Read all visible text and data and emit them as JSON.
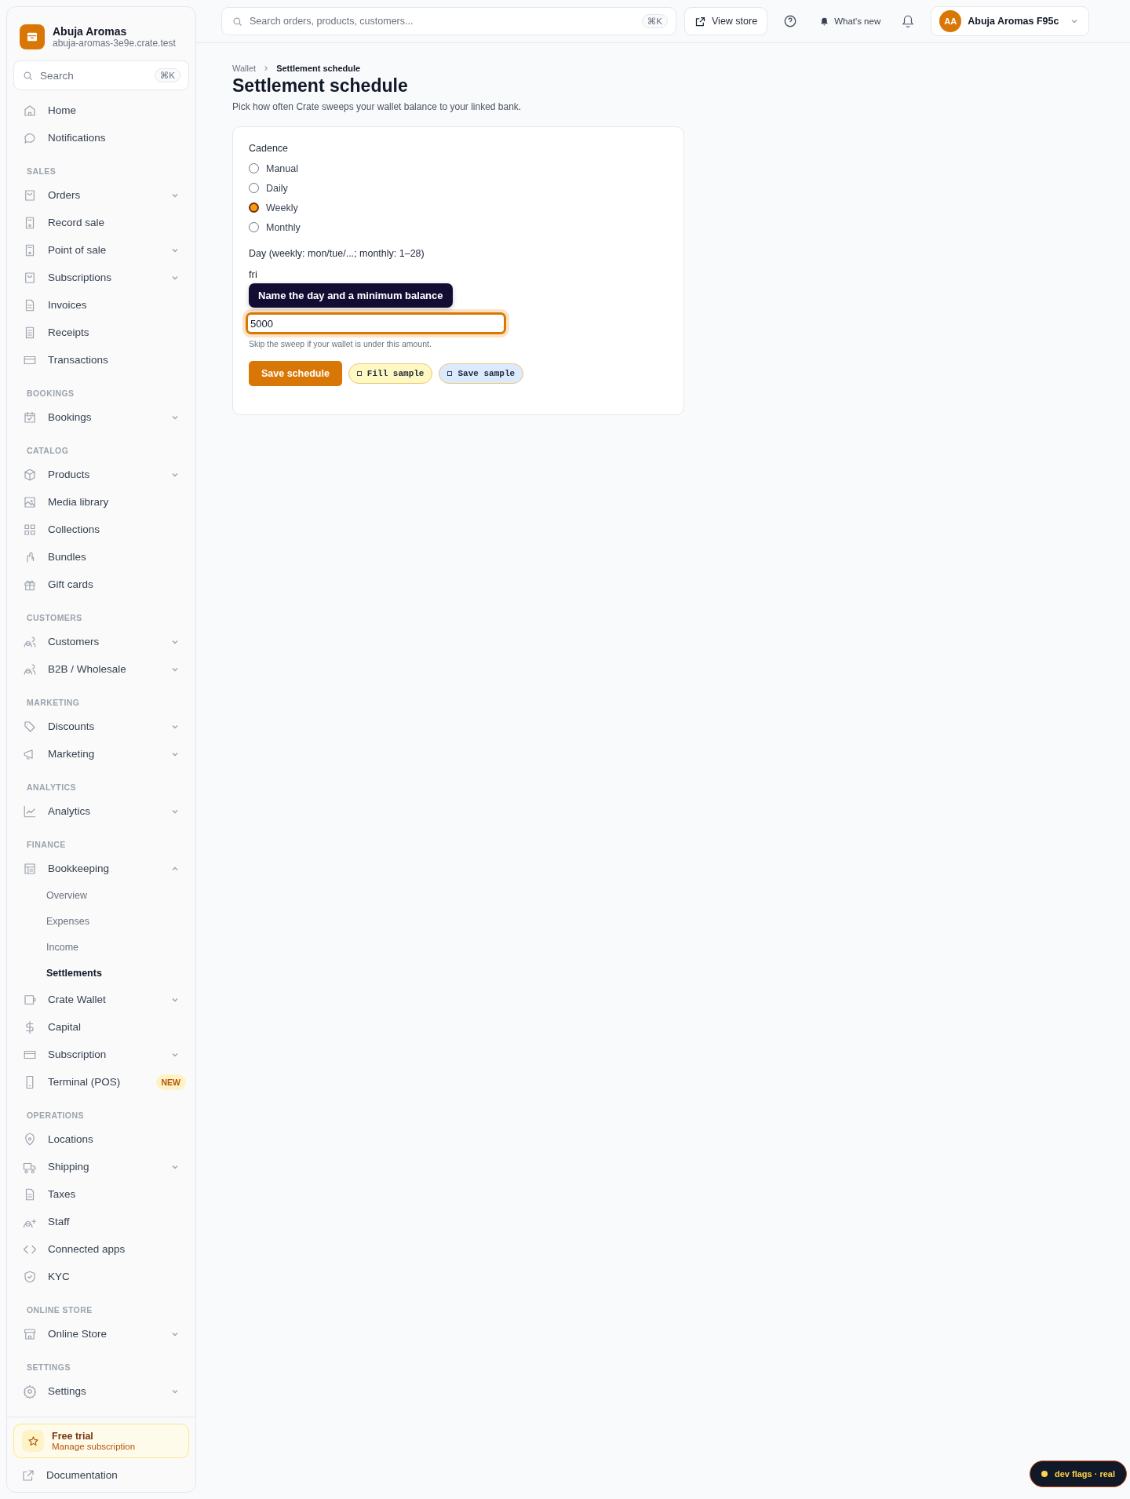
{
  "store": {
    "name": "Abuja Aromas",
    "domain": "abuja-aromas-3e9e.crate.test"
  },
  "sidebar_search": {
    "placeholder": "Search",
    "shortcut": "⌘K"
  },
  "sidebar": {
    "top_items": [
      {
        "label": "Home"
      },
      {
        "label": "Notifications"
      }
    ],
    "sections": [
      {
        "title": "SALES",
        "items": [
          {
            "label": "Orders",
            "expanded": false
          },
          {
            "label": "Record sale"
          },
          {
            "label": "Point of sale",
            "expanded": false
          },
          {
            "label": "Subscriptions",
            "expanded": false
          },
          {
            "label": "Invoices"
          },
          {
            "label": "Receipts"
          },
          {
            "label": "Transactions"
          }
        ]
      },
      {
        "title": "BOOKINGS",
        "items": [
          {
            "label": "Bookings",
            "expanded": false
          }
        ]
      },
      {
        "title": "CATALOG",
        "items": [
          {
            "label": "Products",
            "expanded": false
          },
          {
            "label": "Media library"
          },
          {
            "label": "Collections"
          },
          {
            "label": "Bundles"
          },
          {
            "label": "Gift cards"
          }
        ]
      },
      {
        "title": "CUSTOMERS",
        "items": [
          {
            "label": "Customers",
            "expanded": false
          },
          {
            "label": "B2B / Wholesale",
            "expanded": false
          }
        ]
      },
      {
        "title": "MARKETING",
        "items": [
          {
            "label": "Discounts",
            "expanded": false
          },
          {
            "label": "Marketing",
            "expanded": false
          }
        ]
      },
      {
        "title": "ANALYTICS",
        "items": [
          {
            "label": "Analytics",
            "expanded": false
          }
        ]
      },
      {
        "title": "FINANCE",
        "items": [
          {
            "label": "Bookkeeping",
            "expanded": true,
            "children": [
              {
                "label": "Overview",
                "selected": false
              },
              {
                "label": "Expenses",
                "selected": false
              },
              {
                "label": "Income",
                "selected": false
              },
              {
                "label": "Settlements",
                "selected": true
              }
            ]
          },
          {
            "label": "Crate Wallet",
            "expanded": false
          },
          {
            "label": "Capital"
          },
          {
            "label": "Subscription",
            "expanded": false
          },
          {
            "label": "Terminal (POS)",
            "badge": "NEW"
          }
        ]
      },
      {
        "title": "OPERATIONS",
        "items": [
          {
            "label": "Locations"
          },
          {
            "label": "Shipping",
            "expanded": false
          },
          {
            "label": "Taxes"
          },
          {
            "label": "Staff"
          },
          {
            "label": "Connected apps"
          },
          {
            "label": "KYC"
          }
        ]
      },
      {
        "title": "ONLINE STORE",
        "items": [
          {
            "label": "Online Store",
            "expanded": false
          }
        ]
      },
      {
        "title": "SETTINGS",
        "items": [
          {
            "label": "Settings",
            "expanded": false
          }
        ]
      }
    ],
    "trial": {
      "title": "Free trial",
      "link": "Manage subscription"
    },
    "footer_link": "Documentation"
  },
  "topbar": {
    "search": {
      "placeholder": "Search orders, products, customers...",
      "shortcut": "⌘K"
    },
    "view_store": "View store",
    "whats_new": "What's new",
    "account": {
      "initials": "AA",
      "name": "Abuja Aromas F95c"
    }
  },
  "breadcrumb": [
    "Wallet",
    "Settlement schedule"
  ],
  "title": "Settlement schedule",
  "subtitle": "Pick how often Crate sweeps your wallet balance to your linked bank.",
  "form": {
    "cadence_label": "Cadence",
    "options": [
      {
        "label": "Manual",
        "selected": false
      },
      {
        "label": "Daily",
        "selected": false
      },
      {
        "label": "Weekly",
        "selected": true
      },
      {
        "label": "Monthly",
        "selected": false
      }
    ],
    "day_label": "Day (weekly: mon/tue/...; monthly: 1–28)",
    "day_value": "fri",
    "tooltip": "Name the day and a minimum balance",
    "min_balance_value": "5000",
    "min_balance_hint": "Skip the sweep if your wallet is under this amount.",
    "save_button": "Save schedule",
    "sample_buttons": [
      {
        "label": "Fill sample",
        "kind": "fill"
      },
      {
        "label": "Save sample",
        "kind": "save"
      }
    ]
  },
  "dev_flags": "dev flags · real"
}
